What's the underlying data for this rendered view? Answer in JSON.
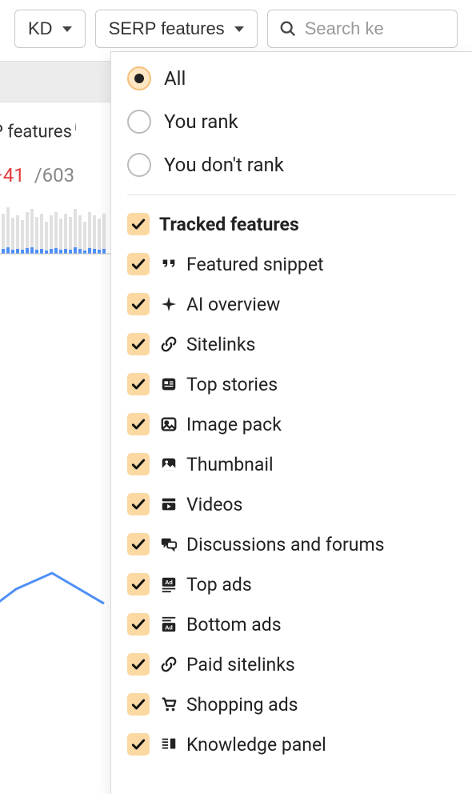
{
  "toolbar": {
    "kd_label": "KD",
    "serp_label": "SERP features",
    "search_placeholder": "Search ke"
  },
  "background": {
    "features_label": "P features",
    "delta": "−41",
    "total": "/603"
  },
  "radios": [
    {
      "label": "All",
      "selected": true
    },
    {
      "label": "You rank",
      "selected": false
    },
    {
      "label": "You don't rank",
      "selected": false
    }
  ],
  "header_checkbox": {
    "label": "Tracked features"
  },
  "features": [
    {
      "label": "Featured snippet",
      "icon": "quote"
    },
    {
      "label": "AI overview",
      "icon": "sparkle"
    },
    {
      "label": "Sitelinks",
      "icon": "link"
    },
    {
      "label": "Top stories",
      "icon": "news"
    },
    {
      "label": "Image pack",
      "icon": "image"
    },
    {
      "label": "Thumbnail",
      "icon": "thumb"
    },
    {
      "label": "Videos",
      "icon": "video"
    },
    {
      "label": "Discussions and forums",
      "icon": "discuss"
    },
    {
      "label": "Top ads",
      "icon": "topads"
    },
    {
      "label": "Bottom ads",
      "icon": "bottomads"
    },
    {
      "label": "Paid sitelinks",
      "icon": "link"
    },
    {
      "label": "Shopping ads",
      "icon": "cart"
    },
    {
      "label": "Knowledge panel",
      "icon": "knowledge"
    }
  ]
}
